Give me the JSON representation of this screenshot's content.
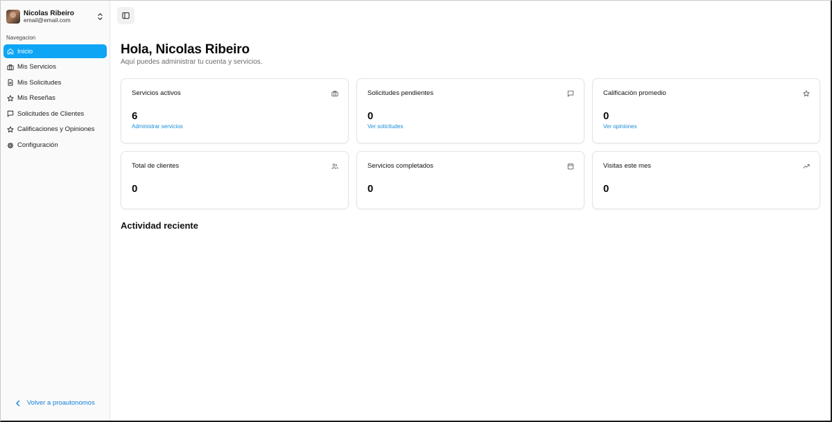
{
  "user": {
    "name": "Nicolas Ribeiro",
    "email": "email@email.com"
  },
  "sidebar": {
    "section_label": "Navegacion",
    "items": [
      {
        "label": "Inicio",
        "icon": "home-icon",
        "active": true
      },
      {
        "label": "Mis Servicios",
        "icon": "briefcase-icon"
      },
      {
        "label": "Mis Solicitudes",
        "icon": "file-icon"
      },
      {
        "label": "Mis Reseñas",
        "icon": "star-icon"
      },
      {
        "label": "Solicitudes de Clientes",
        "icon": "message-icon"
      },
      {
        "label": "Calificaciones y Opiniones",
        "icon": "star-icon"
      },
      {
        "label": "Configuración",
        "icon": "gear-icon"
      }
    ],
    "back_label": "Volver a proautonomos"
  },
  "main": {
    "title": "Hola, Nicolas Ribeiro",
    "subtitle": "Aquí puedes administrar tu cuenta y servicios.",
    "cards": [
      {
        "title": "Servicios activos",
        "value": "6",
        "link": "Administrar servicios",
        "icon": "briefcase-icon"
      },
      {
        "title": "Solicitudes pendientes",
        "value": "0",
        "link": "Ver solicitudes",
        "icon": "message-icon"
      },
      {
        "title": "Calificación promedio",
        "value": "0",
        "link": "Ver opiniones",
        "icon": "star-icon"
      },
      {
        "title": "Total de clientes",
        "value": "0",
        "icon": "users-icon"
      },
      {
        "title": "Servicios completados",
        "value": "0",
        "icon": "calendar-icon"
      },
      {
        "title": "Visitas este mes",
        "value": "0",
        "icon": "trending-up-icon"
      }
    ],
    "recent_title": "Actividad reciente"
  },
  "colors": {
    "accent": "#0ea5f5",
    "link": "#1a8cd8"
  }
}
